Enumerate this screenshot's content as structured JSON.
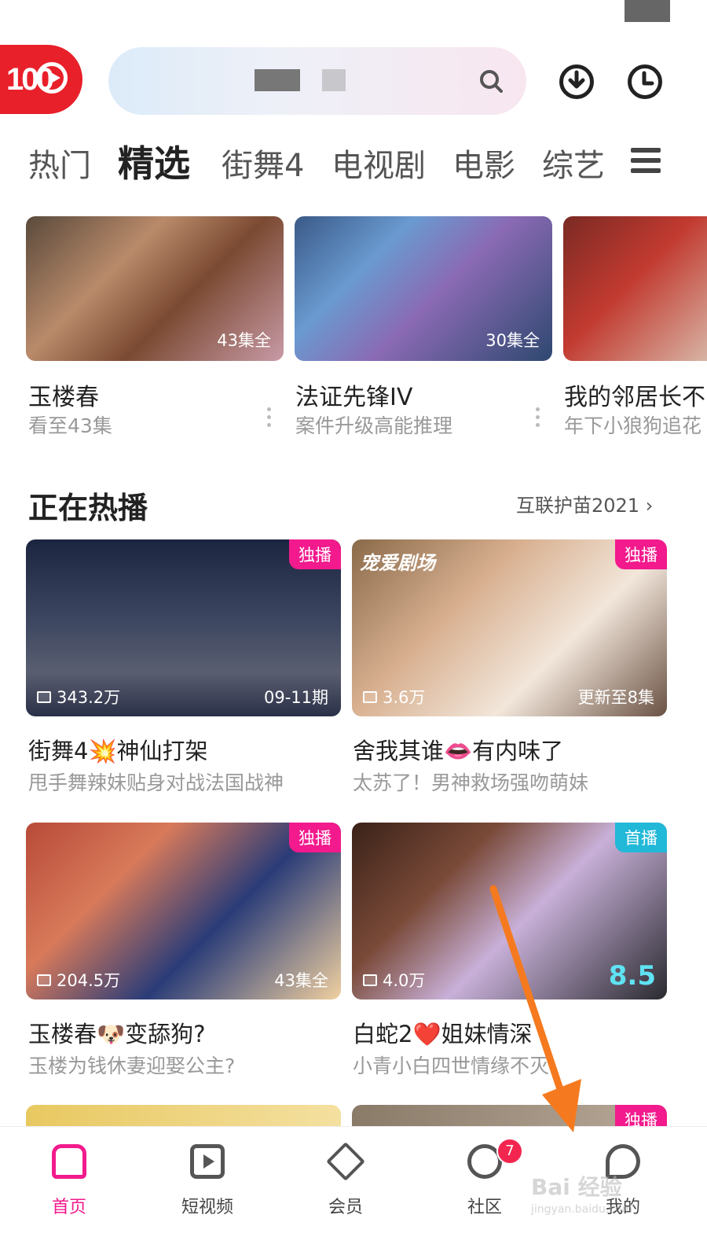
{
  "header": {
    "logo_text": "100",
    "search_icon": "search-icon",
    "download_icon": "download-icon",
    "history_icon": "clock-icon"
  },
  "tabs": [
    "热门",
    "精选",
    "街舞4",
    "电视剧",
    "电影",
    "综艺"
  ],
  "top_cards": [
    {
      "title": "玉楼春",
      "sub": "看至43集",
      "badge": "43集全"
    },
    {
      "title": "法证先锋IV",
      "sub": "案件升级高能推理",
      "badge": "30集全"
    },
    {
      "title": "我的邻居长不",
      "sub": "年下小狼狗追花"
    }
  ],
  "section": {
    "title": "正在热播",
    "link": "互联护苗2021"
  },
  "grid": [
    {
      "tag": "独播",
      "views": "343.2万",
      "ep": "09-11期",
      "title": "街舞4💥神仙打架",
      "sub": "甩手舞辣妹贴身对战法国战神"
    },
    {
      "tag": "独播",
      "views": "3.6万",
      "ep": "更新至8集",
      "title": "舍我其谁👄有内味了",
      "sub": "太苏了！男神救场强吻萌妹",
      "overlay": "宠爱剧场"
    },
    {
      "tag": "独播",
      "views": "204.5万",
      "ep": "43集全",
      "title": "玉楼春🐶变舔狗?",
      "sub": "玉楼为钱休妻迎娶公主?"
    },
    {
      "tag": "首播",
      "views": "4.0万",
      "score": "8.5",
      "title": "白蛇2❤️姐妹情深",
      "sub": "小青小白四世情缘不灭"
    },
    {
      "tag": "独播"
    }
  ],
  "nav": [
    {
      "label": "首页",
      "icon": "home-icon"
    },
    {
      "label": "短视频",
      "icon": "play-square-icon"
    },
    {
      "label": "会员",
      "icon": "diamond-icon"
    },
    {
      "label": "社区",
      "icon": "community-icon",
      "badge": "7"
    },
    {
      "label": "我的",
      "icon": "profile-icon"
    }
  ],
  "watermark": {
    "line1": "Bai 经验",
    "line2": "jingyan.baidu.com"
  }
}
